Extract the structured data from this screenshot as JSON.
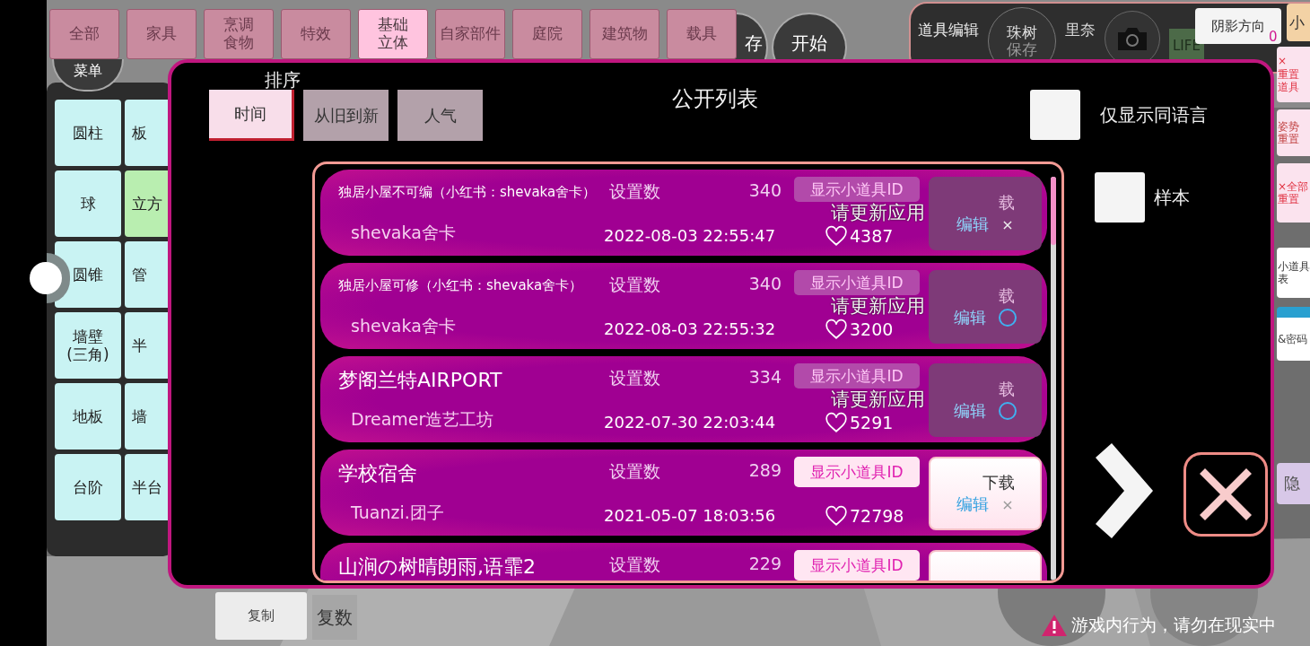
{
  "category_tabs": [
    {
      "label": "全部",
      "selected": false
    },
    {
      "label": "家具",
      "selected": false
    },
    {
      "label": "烹调食物",
      "selected": false,
      "wrap": true
    },
    {
      "label": "特效",
      "selected": false
    },
    {
      "label": "基础立体",
      "selected": true,
      "wrap": true
    },
    {
      "label": "自家部件",
      "selected": false
    },
    {
      "label": "庭院",
      "selected": false
    },
    {
      "label": "建筑物",
      "selected": false
    },
    {
      "label": "载具",
      "selected": false
    }
  ],
  "hud_buttons": [
    {
      "label": "菜单"
    },
    {
      "label": "存"
    },
    {
      "label": "开始"
    }
  ],
  "shapes": [
    {
      "label": "圆柱",
      "selected": false
    },
    {
      "label": "板",
      "selected": false
    },
    {
      "label": "球",
      "selected": false
    },
    {
      "label": "立方",
      "selected": true
    },
    {
      "label": "圆锥",
      "selected": false
    },
    {
      "label": "管",
      "selected": false
    },
    {
      "label": "墙壁\n(三角)",
      "selected": false
    },
    {
      "label": "半",
      "selected": false
    },
    {
      "label": "地板",
      "selected": false
    },
    {
      "label": "墙",
      "selected": false
    },
    {
      "label": "台阶",
      "selected": false
    },
    {
      "label": "半台",
      "selected": false
    }
  ],
  "edit_panel": {
    "title": "道具编辑",
    "character": "珠树",
    "save": "保存",
    "second_character": "里奈",
    "life": "LIFE",
    "shadow_button": "阴影方向",
    "shadow_value": "0",
    "small_tab": "小"
  },
  "side_buttons": [
    {
      "lines": [
        "×",
        "重置",
        "道具"
      ]
    },
    {
      "lines": [
        "姿势",
        "重置"
      ]
    },
    {
      "lines": [
        "×全部",
        "重置"
      ]
    },
    {
      "lines": [
        "小道具",
        "表"
      ]
    },
    {
      "lines": [
        "&密码"
      ]
    },
    {
      "lines": [
        "隐"
      ]
    }
  ],
  "modal": {
    "sort_label": "排序",
    "sort_options": [
      {
        "label": "时间",
        "selected": true
      },
      {
        "label": "从旧到新",
        "selected": false
      },
      {
        "label": "人气",
        "selected": false
      }
    ],
    "title": "公开列表",
    "filters": [
      {
        "label": "仅显示同语言",
        "checked": false
      },
      {
        "label": "样本",
        "checked": false
      }
    ],
    "rows": [
      {
        "title": "独居小屋不可编（小红书：shevaka舍卡）",
        "author": "shevaka舍卡",
        "count_label": "设置数",
        "count": "340",
        "date": "2022-08-03 22:55:47",
        "likes": "4387",
        "id_button": "显示小道具ID",
        "disabled": true,
        "notice": "请更新应用",
        "download": "载",
        "edit": "编辑",
        "mark": {
          "kind": "cross",
          "text": "×"
        }
      },
      {
        "title": "独居小屋可修（小红书：shevaka舍卡）",
        "author": "shevaka舍卡",
        "count_label": "设置数",
        "count": "340",
        "date": "2022-08-03 22:55:32",
        "likes": "3200",
        "id_button": "显示小道具ID",
        "disabled": true,
        "notice": "请更新应用",
        "download": "载",
        "edit": "编辑",
        "mark": {
          "kind": "circle"
        }
      },
      {
        "title": "梦阁兰特AIRPORT",
        "author": "Dreamer造艺工坊",
        "count_label": "设置数",
        "count": "334",
        "date": "2022-07-30 22:03:44",
        "likes": "5291",
        "id_button": "显示小道具ID",
        "disabled": true,
        "notice": "请更新应用",
        "download": "载",
        "edit": "编辑",
        "mark": {
          "kind": "circle"
        }
      },
      {
        "title": "学校宿舍",
        "author": "Tuanzi.团子",
        "count_label": "设置数",
        "count": "289",
        "date": "2021-05-07 18:03:56",
        "likes": "72798",
        "id_button": "显示小道具ID",
        "disabled": false,
        "download": "下载",
        "edit": "编辑",
        "mark": {
          "kind": "cross",
          "text": "×"
        }
      },
      {
        "title": "山涧の树晴朗雨,语霏2",
        "count_label": "设置数",
        "count": "229",
        "id_button": "显示小道具ID",
        "disabled": false
      }
    ]
  },
  "bottom": {
    "copy": "复制",
    "multiple": "复数",
    "warning": "游戏内行为，请勿在现实中"
  }
}
